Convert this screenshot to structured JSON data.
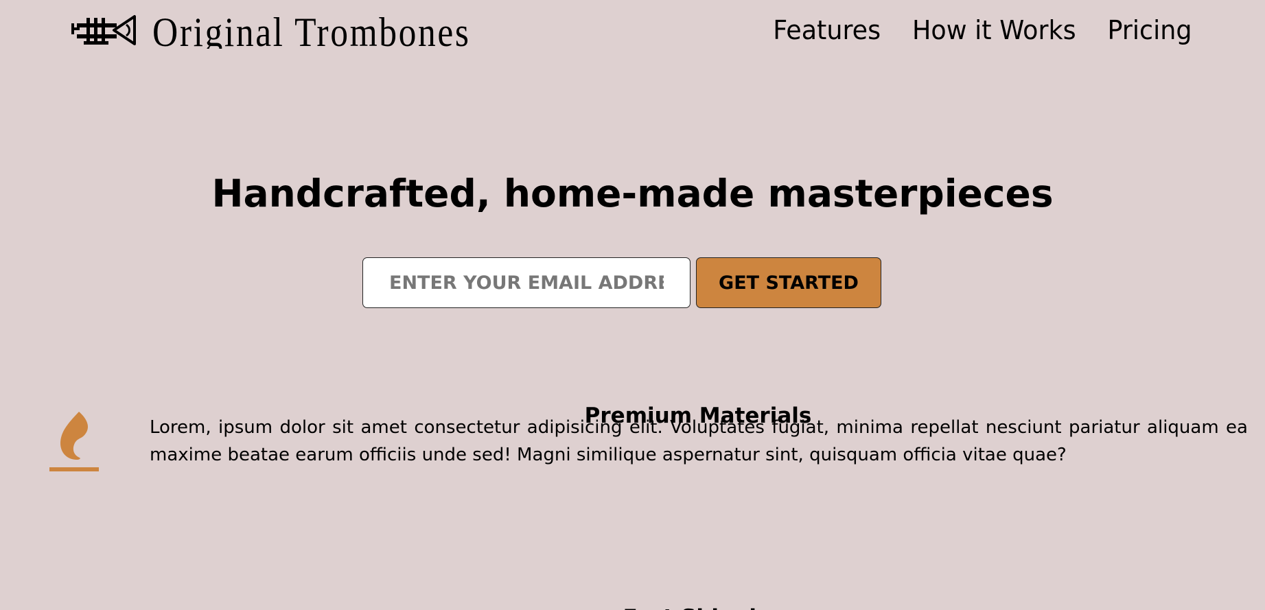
{
  "header": {
    "logo_icon": "trombone-icon",
    "logo_text": "Original Trombones",
    "nav": [
      {
        "label": "Features"
      },
      {
        "label": "How it Works"
      },
      {
        "label": "Pricing"
      }
    ]
  },
  "hero": {
    "title": "Handcrafted, home-made masterpieces",
    "email_placeholder": "ENTER YOUR EMAIL ADDRESS",
    "cta_label": "GET STARTED"
  },
  "features": [
    {
      "icon": "fire-icon",
      "title": "Premium Materials",
      "description": "Lorem, ipsum dolor sit amet consectetur adipisicing elit. Voluptates fugiat, minima repellat nesciunt pariatur aliquam ea maxime beatae earum officiis unde sed! Magni similique aspernatur sint, quisquam officia vitae quae?"
    },
    {
      "title": "Fast Shipping"
    }
  ],
  "colors": {
    "background": "#ded0d0",
    "accent": "#cd853f",
    "text": "#000000"
  }
}
